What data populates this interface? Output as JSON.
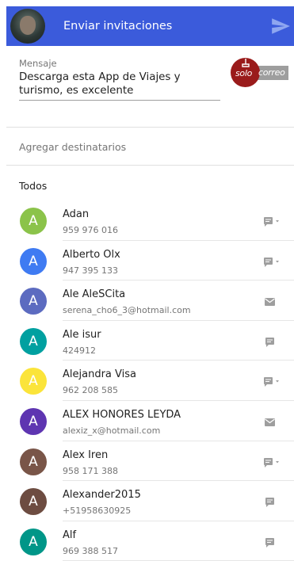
{
  "header": {
    "title": "Enviar invitaciones"
  },
  "message": {
    "label": "Mensaje",
    "text": "Descarga esta App de Viajes y turismo, es excelente"
  },
  "logo": {
    "word1": "solo",
    "word2": "correo"
  },
  "add_recipients": {
    "placeholder": "Agregar destinatarios"
  },
  "section": {
    "title": "Todos"
  },
  "colors": {
    "app_bar": "#3b5bdb",
    "logo_red": "#9a1b1b"
  },
  "contacts": [
    {
      "initial": "A",
      "name": "Adan",
      "detail": "959 976 016",
      "color": "#8bc34a",
      "action": "sms-dropdown-icon"
    },
    {
      "initial": "A",
      "name": "Alberto Olx",
      "detail": "947 395 133",
      "color": "#3f7bf2",
      "action": "sms-dropdown-icon"
    },
    {
      "initial": "A",
      "name": "Ale AleSCita",
      "detail": "serena_cho6_3@hotmail.com",
      "color": "#5c6bc0",
      "action": "email-icon"
    },
    {
      "initial": "A",
      "name": "Ale isur",
      "detail": "424912",
      "color": "#00a0a0",
      "action": "sms-icon"
    },
    {
      "initial": "A",
      "name": "Alejandra Visa",
      "detail": "962 208 585",
      "color": "#fbe43a",
      "action": "sms-dropdown-icon"
    },
    {
      "initial": "A",
      "name": "ALEX HONORES LEYDA",
      "detail": "alexiz_x@hotmail.com",
      "color": "#5e35b1",
      "action": "email-icon"
    },
    {
      "initial": "A",
      "name": "Alex Iren",
      "detail": "958 171 388",
      "color": "#795548",
      "action": "sms-dropdown-icon"
    },
    {
      "initial": "A",
      "name": "Alexander2015",
      "detail": "+51958630925",
      "color": "#6d4c41",
      "action": "sms-icon"
    },
    {
      "initial": "A",
      "name": "Alf",
      "detail": "969 388 517",
      "color": "#009688",
      "action": "sms-icon"
    }
  ]
}
